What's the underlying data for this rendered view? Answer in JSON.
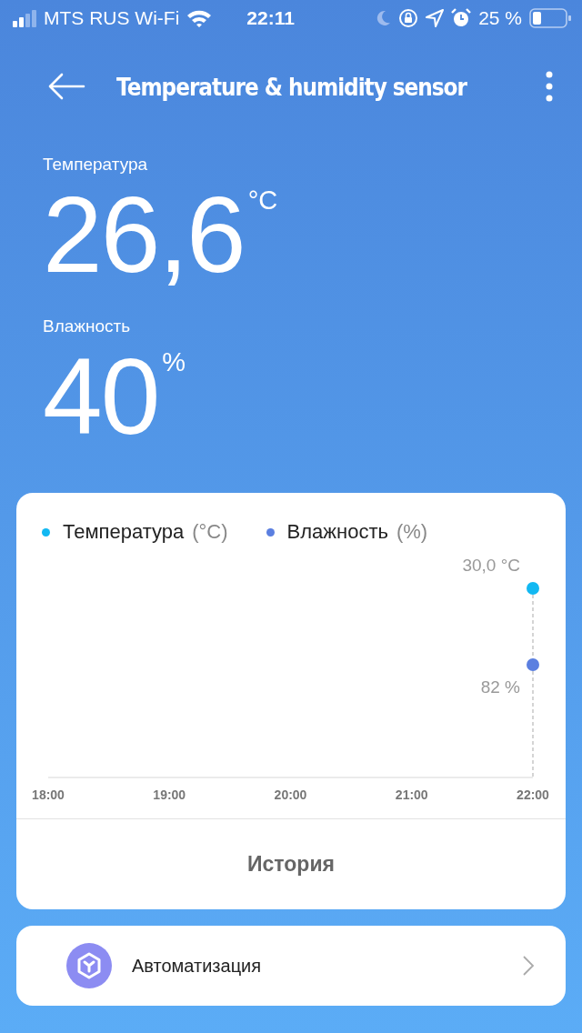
{
  "status_bar": {
    "carrier": "MTS RUS Wi-Fi",
    "time": "22:11",
    "battery": "25 %"
  },
  "header": {
    "title": "Temperature & humidity sensor"
  },
  "readings": [
    {
      "label": "Температура",
      "value": "26,6",
      "unit": "°C"
    },
    {
      "label": "Влажность",
      "value": "40",
      "unit": "%"
    }
  ],
  "chart_card": {
    "legend": [
      {
        "name": "Температура",
        "unit": "(°C)",
        "color": "#12b8f2"
      },
      {
        "name": "Влажность",
        "unit": "(%)",
        "color": "#5b7fe0"
      }
    ],
    "time_labels": [
      "18:00",
      "19:00",
      "20:00",
      "21:00",
      "22:00"
    ],
    "point_labels": [
      "30,0 °C",
      "82 %"
    ],
    "history_button": "История"
  },
  "automation": {
    "label": "Автоматизация"
  }
}
